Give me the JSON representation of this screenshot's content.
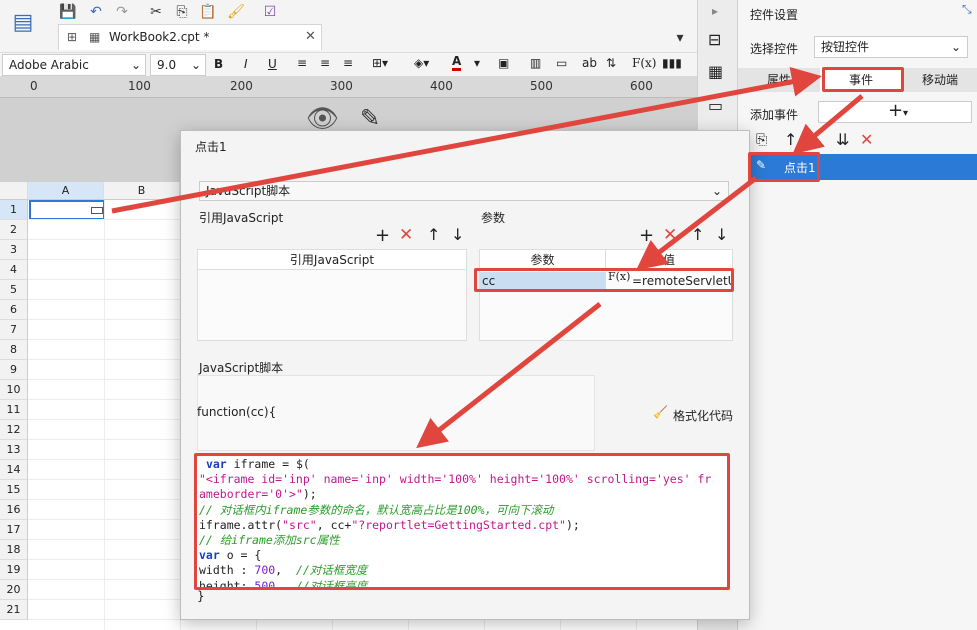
{
  "toolbar": {
    "tab_title": "WorkBook2.cpt *",
    "font_name": "Adobe Arabic",
    "font_size": "9.0",
    "bold": "B",
    "italic": "I",
    "underline": "U",
    "text_btn": "ab",
    "formula_btn": "F(x)"
  },
  "ruler": {
    "ticks": [
      "0",
      "100",
      "200",
      "300",
      "400",
      "500",
      "600"
    ]
  },
  "grid": {
    "columns": [
      "A",
      "B"
    ],
    "rows": [
      "1",
      "2",
      "3",
      "4",
      "5",
      "6",
      "7",
      "8",
      "9",
      "10",
      "11",
      "12",
      "13",
      "14",
      "15",
      "16",
      "17",
      "18",
      "19",
      "20",
      "21"
    ]
  },
  "right_panel": {
    "title": "控件设置",
    "select_label": "选择控件",
    "select_value": "按钮控件",
    "tabs": [
      "属性",
      "事件",
      "移动端"
    ],
    "add_event_label": "添加事件",
    "add_symbol": "+",
    "event_item": "点击1"
  },
  "dialog": {
    "title": "点击1",
    "type_value": "JavaScript脚本",
    "ref_js_section": "引用JavaScript",
    "params_section": "参数",
    "ref_js_header": "引用JavaScript",
    "param_col": "参数",
    "value_col": "值",
    "param_name": "cc",
    "param_value": "=remoteServletU",
    "fx_label": "F(x)",
    "script_section": "JavaScript脚本",
    "func_sig": "function(cc){",
    "format_btn": "格式化代码",
    "closing_brace": "}"
  },
  "colors": {
    "accent_red": "#e0463e",
    "selection_blue": "#2a7ad6",
    "brand_blue": "#3a6db5"
  }
}
